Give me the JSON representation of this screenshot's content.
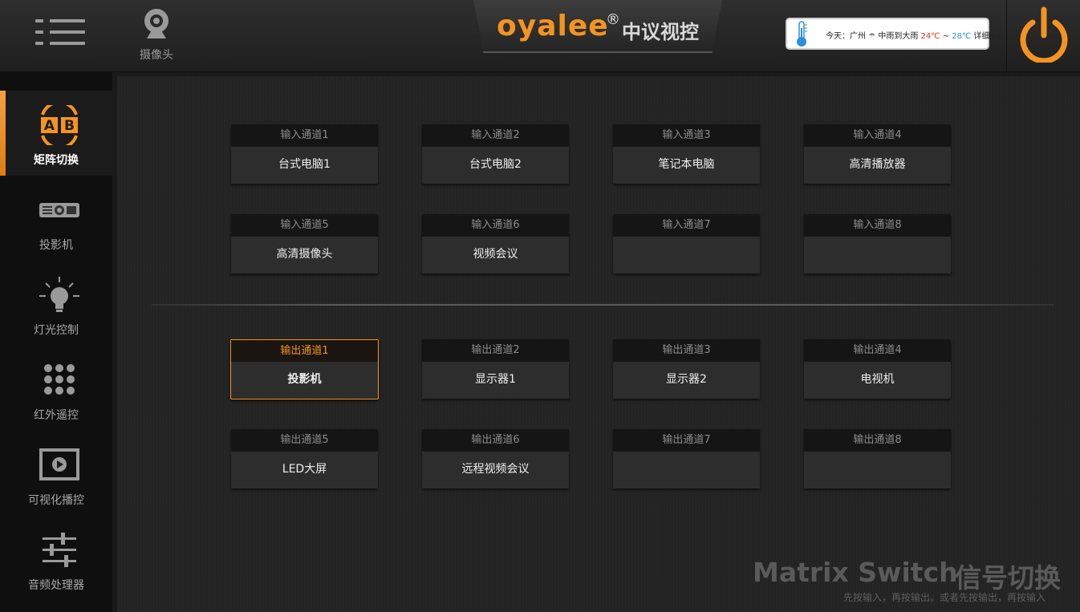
{
  "header": {
    "camera_label": "摄像头",
    "logo_text": "oyalee",
    "logo_reg": "®",
    "logo_cn": "中议视控",
    "weather": {
      "prefix": "今天：广州",
      "condition": "中雨到大雨",
      "temp_high": "24℃",
      "separator": "~",
      "temp_low": "28℃",
      "detail": "详细»"
    }
  },
  "colors": {
    "accent": "#f39422",
    "hot": "#e8341c",
    "cold": "#2b8fd9"
  },
  "sidebar": {
    "items": [
      {
        "label": "矩阵切换",
        "icon": "ab-icon",
        "active": true
      },
      {
        "label": "投影机",
        "icon": "projector-icon",
        "active": false
      },
      {
        "label": "灯光控制",
        "icon": "light-bulb-icon",
        "active": false
      },
      {
        "label": "红外遥控",
        "icon": "keypad-icon",
        "active": false
      },
      {
        "label": "可视化播控",
        "icon": "play-screen-icon",
        "active": false
      },
      {
        "label": "音频处理器",
        "icon": "sliders-icon",
        "active": false
      }
    ]
  },
  "inputs": [
    {
      "header": "输入通道1",
      "device": "台式电脑1"
    },
    {
      "header": "输入通道2",
      "device": "台式电脑2"
    },
    {
      "header": "输入通道3",
      "device": "笔记本电脑"
    },
    {
      "header": "输入通道4",
      "device": "高清播放器"
    },
    {
      "header": "输入通道5",
      "device": "高清摄像头"
    },
    {
      "header": "输入通道6",
      "device": "视频会议"
    },
    {
      "header": "输入通道7",
      "device": ""
    },
    {
      "header": "输入通道8",
      "device": ""
    }
  ],
  "outputs": [
    {
      "header": "输出通道1",
      "device": "投影机",
      "selected": true
    },
    {
      "header": "输出通道2",
      "device": "显示器1"
    },
    {
      "header": "输出通道3",
      "device": "显示器2"
    },
    {
      "header": "输出通道4",
      "device": "电视机"
    },
    {
      "header": "输出通道5",
      "device": "LED大屏"
    },
    {
      "header": "输出通道6",
      "device": "远程视频会议"
    },
    {
      "header": "输出通道7",
      "device": ""
    },
    {
      "header": "输出通道8",
      "device": ""
    }
  ],
  "footer": {
    "title_en": "Matrix Switch",
    "title_cn": "信号切换",
    "hint": "先按输入，再按输出。或者先按输出，再按输入"
  }
}
